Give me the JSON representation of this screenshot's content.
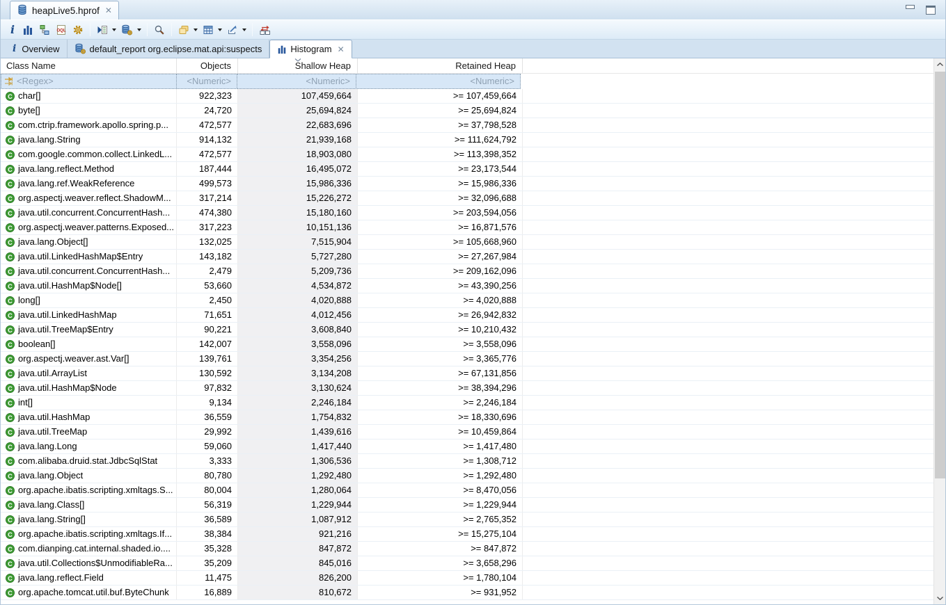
{
  "glyphs": {
    "close": "✕"
  },
  "editor": {
    "tab_title": "heapLive5.hprof"
  },
  "toolbar": {
    "buttons": [
      "info",
      "histogram",
      "dominator-tree",
      "oql",
      "thread-overview",
      "run-expert-test",
      "query-browser",
      "search",
      "group-by",
      "calculate-retained-size",
      "export",
      "compare-tables"
    ]
  },
  "view_tabs": [
    {
      "label": "Overview",
      "icon": "info-icon",
      "active": false
    },
    {
      "label": "default_report org.eclipse.mat.api:suspects",
      "icon": "report-icon",
      "active": false
    },
    {
      "label": "Histogram",
      "icon": "histogram-icon",
      "active": true,
      "closable": true
    }
  ],
  "table": {
    "columns": [
      "Class Name",
      "Objects",
      "Shallow Heap",
      "Retained Heap"
    ],
    "sort": {
      "column": "Shallow Heap",
      "direction": "descending"
    },
    "filter": {
      "class_name": "<Regex>",
      "objects": "<Numeric>",
      "shallow_heap": "<Numeric>",
      "retained_heap": "<Numeric>"
    },
    "rows": [
      {
        "class_name": "char[]",
        "objects": "922,323",
        "shallow_heap": "107,459,664",
        "retained_heap": ">= 107,459,664"
      },
      {
        "class_name": "byte[]",
        "objects": "24,720",
        "shallow_heap": "25,694,824",
        "retained_heap": ">= 25,694,824"
      },
      {
        "class_name": "com.ctrip.framework.apollo.spring.p...",
        "objects": "472,577",
        "shallow_heap": "22,683,696",
        "retained_heap": ">= 37,798,528"
      },
      {
        "class_name": "java.lang.String",
        "objects": "914,132",
        "shallow_heap": "21,939,168",
        "retained_heap": ">= 111,624,792"
      },
      {
        "class_name": "com.google.common.collect.LinkedL...",
        "objects": "472,577",
        "shallow_heap": "18,903,080",
        "retained_heap": ">= 113,398,352"
      },
      {
        "class_name": "java.lang.reflect.Method",
        "objects": "187,444",
        "shallow_heap": "16,495,072",
        "retained_heap": ">= 23,173,544"
      },
      {
        "class_name": "java.lang.ref.WeakReference",
        "objects": "499,573",
        "shallow_heap": "15,986,336",
        "retained_heap": ">= 15,986,336"
      },
      {
        "class_name": "org.aspectj.weaver.reflect.ShadowM...",
        "objects": "317,214",
        "shallow_heap": "15,226,272",
        "retained_heap": ">= 32,096,688"
      },
      {
        "class_name": "java.util.concurrent.ConcurrentHash...",
        "objects": "474,380",
        "shallow_heap": "15,180,160",
        "retained_heap": ">= 203,594,056"
      },
      {
        "class_name": "org.aspectj.weaver.patterns.Exposed...",
        "objects": "317,223",
        "shallow_heap": "10,151,136",
        "retained_heap": ">= 16,871,576"
      },
      {
        "class_name": "java.lang.Object[]",
        "objects": "132,025",
        "shallow_heap": "7,515,904",
        "retained_heap": ">= 105,668,960"
      },
      {
        "class_name": "java.util.LinkedHashMap$Entry",
        "objects": "143,182",
        "shallow_heap": "5,727,280",
        "retained_heap": ">= 27,267,984"
      },
      {
        "class_name": "java.util.concurrent.ConcurrentHash...",
        "objects": "2,479",
        "shallow_heap": "5,209,736",
        "retained_heap": ">= 209,162,096"
      },
      {
        "class_name": "java.util.HashMap$Node[]",
        "objects": "53,660",
        "shallow_heap": "4,534,872",
        "retained_heap": ">= 43,390,256"
      },
      {
        "class_name": "long[]",
        "objects": "2,450",
        "shallow_heap": "4,020,888",
        "retained_heap": ">= 4,020,888"
      },
      {
        "class_name": "java.util.LinkedHashMap",
        "objects": "71,651",
        "shallow_heap": "4,012,456",
        "retained_heap": ">= 26,942,832"
      },
      {
        "class_name": "java.util.TreeMap$Entry",
        "objects": "90,221",
        "shallow_heap": "3,608,840",
        "retained_heap": ">= 10,210,432"
      },
      {
        "class_name": "boolean[]",
        "objects": "142,007",
        "shallow_heap": "3,558,096",
        "retained_heap": ">= 3,558,096"
      },
      {
        "class_name": "org.aspectj.weaver.ast.Var[]",
        "objects": "139,761",
        "shallow_heap": "3,354,256",
        "retained_heap": ">= 3,365,776"
      },
      {
        "class_name": "java.util.ArrayList",
        "objects": "130,592",
        "shallow_heap": "3,134,208",
        "retained_heap": ">= 67,131,856"
      },
      {
        "class_name": "java.util.HashMap$Node",
        "objects": "97,832",
        "shallow_heap": "3,130,624",
        "retained_heap": ">= 38,394,296"
      },
      {
        "class_name": "int[]",
        "objects": "9,134",
        "shallow_heap": "2,246,184",
        "retained_heap": ">= 2,246,184"
      },
      {
        "class_name": "java.util.HashMap",
        "objects": "36,559",
        "shallow_heap": "1,754,832",
        "retained_heap": ">= 18,330,696"
      },
      {
        "class_name": "java.util.TreeMap",
        "objects": "29,992",
        "shallow_heap": "1,439,616",
        "retained_heap": ">= 10,459,864"
      },
      {
        "class_name": "java.lang.Long",
        "objects": "59,060",
        "shallow_heap": "1,417,440",
        "retained_heap": ">= 1,417,480"
      },
      {
        "class_name": "com.alibaba.druid.stat.JdbcSqlStat",
        "objects": "3,333",
        "shallow_heap": "1,306,536",
        "retained_heap": ">= 1,308,712"
      },
      {
        "class_name": "java.lang.Object",
        "objects": "80,780",
        "shallow_heap": "1,292,480",
        "retained_heap": ">= 1,292,480"
      },
      {
        "class_name": "org.apache.ibatis.scripting.xmltags.S...",
        "objects": "80,004",
        "shallow_heap": "1,280,064",
        "retained_heap": ">= 8,470,056"
      },
      {
        "class_name": "java.lang.Class[]",
        "objects": "56,319",
        "shallow_heap": "1,229,944",
        "retained_heap": ">= 1,229,944"
      },
      {
        "class_name": "java.lang.String[]",
        "objects": "36,589",
        "shallow_heap": "1,087,912",
        "retained_heap": ">= 2,765,352"
      },
      {
        "class_name": "org.apache.ibatis.scripting.xmltags.If...",
        "objects": "38,384",
        "shallow_heap": "921,216",
        "retained_heap": ">= 15,275,104"
      },
      {
        "class_name": "com.dianping.cat.internal.shaded.io....",
        "objects": "35,328",
        "shallow_heap": "847,872",
        "retained_heap": ">= 847,872"
      },
      {
        "class_name": "java.util.Collections$UnmodifiableRa...",
        "objects": "35,209",
        "shallow_heap": "845,016",
        "retained_heap": ">= 3,658,296"
      },
      {
        "class_name": "java.lang.reflect.Field",
        "objects": "11,475",
        "shallow_heap": "826,200",
        "retained_heap": ">= 1,780,104"
      },
      {
        "class_name": "org.apache.tomcat.util.buf.ByteChunk",
        "objects": "16,889",
        "shallow_heap": "810,672",
        "retained_heap": ">= 931,952"
      }
    ]
  },
  "colors": {
    "accent_blue": "#2b5797",
    "tab_bg": "#d2e2f1",
    "filter_bg": "#d7e7f7",
    "filter_text": "#8fa1b3",
    "class_icon_green": "#3f9c35",
    "sorted_column_bg": "#f0f0f2"
  }
}
